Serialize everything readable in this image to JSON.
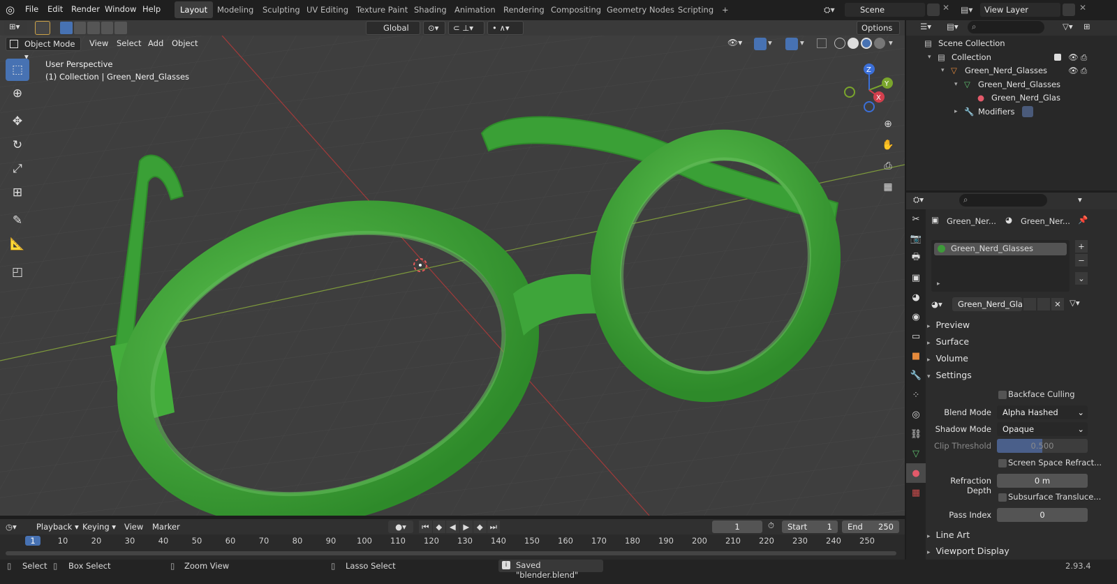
{
  "topbar": {
    "menu": [
      "File",
      "Edit",
      "Render",
      "Window",
      "Help"
    ],
    "workspaces": [
      "Layout",
      "Modeling",
      "Sculpting",
      "UV Editing",
      "Texture Paint",
      "Shading",
      "Animation",
      "Rendering",
      "Compositing",
      "Geometry Nodes",
      "Scripting"
    ],
    "add_tab": "+",
    "scene": "Scene",
    "view_layer": "View Layer"
  },
  "viewport_header": {
    "mode": "Object Mode",
    "menus": [
      "View",
      "Select",
      "Add",
      "Object"
    ],
    "transform_orientation": "Global",
    "options": "Options"
  },
  "viewport": {
    "perspective": "User Perspective",
    "collection_info": "(1) Collection | Green_Nerd_Glasses",
    "axes": {
      "z": "Z",
      "y": "Y",
      "x": "X"
    }
  },
  "tools": [
    "select-box",
    "cursor",
    "move",
    "rotate",
    "scale",
    "transform",
    "annotate",
    "measure",
    "add-cube"
  ],
  "timeline": {
    "menus": [
      "Playback",
      "Keying",
      "View",
      "Marker"
    ],
    "current_frame": "1",
    "start_label": "Start",
    "start": "1",
    "end_label": "End",
    "end": "250",
    "frames": [
      "1",
      "10",
      "20",
      "30",
      "40",
      "50",
      "60",
      "70",
      "80",
      "90",
      "100",
      "110",
      "120",
      "130",
      "140",
      "150",
      "160",
      "170",
      "180",
      "190",
      "200",
      "210",
      "220",
      "230",
      "240",
      "250"
    ]
  },
  "statusbar": {
    "select": "Select",
    "box_select": "Box Select",
    "zoom_view": "Zoom View",
    "lasso_select": "Lasso Select",
    "message": "Saved \"blender.blend\"",
    "version": "2.93.4"
  },
  "outliner": {
    "rows": [
      {
        "label": "Scene Collection",
        "indent": 0
      },
      {
        "label": "Collection",
        "indent": 1
      },
      {
        "label": "Green_Nerd_Glasses",
        "indent": 2
      },
      {
        "label": "Green_Nerd_Glasses",
        "indent": 3
      },
      {
        "label": "Green_Nerd_Glas",
        "indent": 4
      },
      {
        "label": "Modifiers",
        "indent": 3
      }
    ]
  },
  "properties": {
    "breadcrumb_object": "Green_Ner...",
    "breadcrumb_material": "Green_Ner...",
    "slot": "Green_Nerd_Glasses",
    "material_name": "Green_Nerd_Gla...",
    "panels": [
      "Preview",
      "Surface",
      "Volume",
      "Settings",
      "Line Art",
      "Viewport Display"
    ],
    "settings": {
      "backface_culling": "Backface Culling",
      "blend_mode_label": "Blend Mode",
      "blend_mode": "Alpha Hashed",
      "shadow_mode_label": "Shadow Mode",
      "shadow_mode": "Opaque",
      "clip_threshold_label": "Clip Threshold",
      "clip_threshold": "0.500",
      "ssr": "Screen Space Refract...",
      "refraction_depth_label": "Refraction Depth",
      "refraction_depth": "0 m",
      "sss": "Subsurface Transluce...",
      "pass_index_label": "Pass Index",
      "pass_index": "0"
    }
  },
  "colors": {
    "accent": "#4772b3",
    "glasses": "#3ea53a",
    "viewport_bg": "#3e3e3e"
  }
}
